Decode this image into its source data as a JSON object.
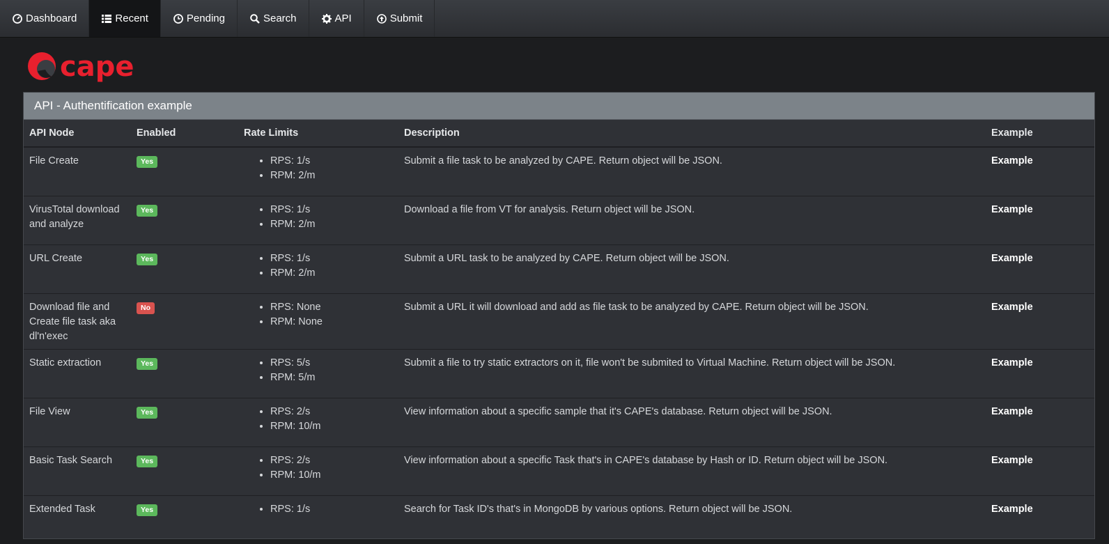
{
  "nav": {
    "items": [
      {
        "label": "Dashboard",
        "icon": "dashboard-icon",
        "active": false
      },
      {
        "label": "Recent",
        "icon": "list-icon",
        "active": true
      },
      {
        "label": "Pending",
        "icon": "clock-icon",
        "active": false
      },
      {
        "label": "Search",
        "icon": "search-icon",
        "active": false
      },
      {
        "label": "API",
        "icon": "gear-icon",
        "active": false
      },
      {
        "label": "Submit",
        "icon": "upload-icon",
        "active": false
      }
    ]
  },
  "logo": {
    "text": "cape",
    "color": "#e8202e"
  },
  "panel": {
    "title": "API - Authentification example"
  },
  "table": {
    "headers": {
      "node": "API Node",
      "enabled": "Enabled",
      "rate": "Rate Limits",
      "desc": "Description",
      "example": "Example"
    },
    "rows": [
      {
        "node": "File Create",
        "enabled": "Yes",
        "rps": "RPS: 1/s",
        "rpm": "RPM: 2/m",
        "desc": "Submit a file task to be analyzed by CAPE. Return object will be JSON.",
        "example": "Example"
      },
      {
        "node": "VirusTotal download and analyze",
        "enabled": "Yes",
        "rps": "RPS: 1/s",
        "rpm": "RPM: 2/m",
        "desc": "Download a file from VT for analysis. Return object will be JSON.",
        "example": "Example"
      },
      {
        "node": "URL Create",
        "enabled": "Yes",
        "rps": "RPS: 1/s",
        "rpm": "RPM: 2/m",
        "desc": "Submit a URL task to be analyzed by CAPE. Return object will be JSON.",
        "example": "Example"
      },
      {
        "node": "Download file and Create file task aka dl'n'exec",
        "enabled": "No",
        "rps": "RPS: None",
        "rpm": "RPM: None",
        "desc": "Submit a URL it will download and add as file task to be analyzed by CAPE. Return object will be JSON.",
        "example": "Example"
      },
      {
        "node": "Static extraction",
        "enabled": "Yes",
        "rps": "RPS: 5/s",
        "rpm": "RPM: 5/m",
        "desc": "Submit a file to try static extractors on it, file won't be submited to Virtual Machine. Return object will be JSON.",
        "example": "Example"
      },
      {
        "node": "File View",
        "enabled": "Yes",
        "rps": "RPS: 2/s",
        "rpm": "RPM: 10/m",
        "desc": "View information about a specific sample that it's CAPE's database. Return object will be JSON.",
        "example": "Example"
      },
      {
        "node": "Basic Task Search",
        "enabled": "Yes",
        "rps": "RPS: 2/s",
        "rpm": "RPM: 10/m",
        "desc": "View information about a specific Task that's in CAPE's database by Hash or ID. Return object will be JSON.",
        "example": "Example"
      },
      {
        "node": "Extended Task",
        "enabled": "Yes",
        "rps": "RPS: 1/s",
        "rpm": "",
        "desc": "Search for Task ID's that's in MongoDB by various options. Return object will be JSON.",
        "example": "Example"
      }
    ]
  }
}
